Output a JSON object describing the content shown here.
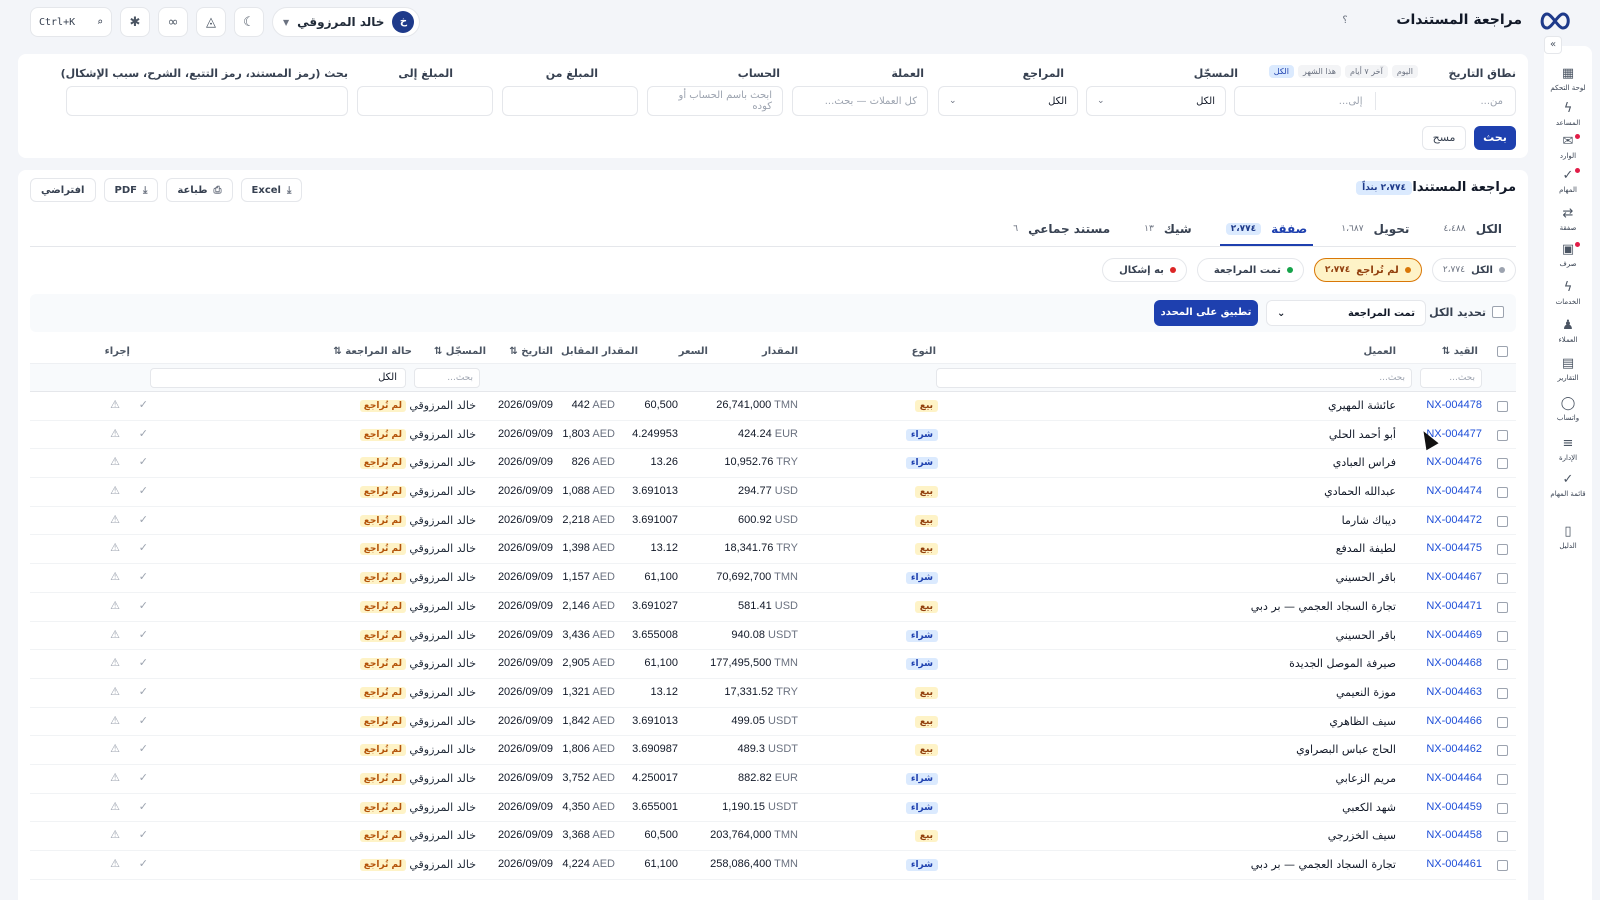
{
  "header": {
    "title": "مراجعة المستندات",
    "help": "؟",
    "search_shortcut": "Ctrl+K",
    "user_name": "خالد المرزوقي",
    "user_initial": "خ"
  },
  "sidebar": [
    {
      "label": "لوحة التحكم",
      "icon": "grid-icon",
      "glyph": "▦"
    },
    {
      "label": "المساعد",
      "icon": "bolt-icon",
      "glyph": "ϟ"
    },
    {
      "label": "الوارد",
      "icon": "inbox-icon",
      "glyph": "✉",
      "dot": true
    },
    {
      "label": "المهام",
      "icon": "check-icon",
      "glyph": "✓",
      "dot": true
    },
    {
      "label": "صفقة",
      "icon": "exchange-icon",
      "glyph": "⇄"
    },
    {
      "label": "صرف",
      "icon": "cash-icon",
      "glyph": "▣",
      "dot": true
    },
    {
      "label": "الخدمات",
      "icon": "bolt-icon",
      "glyph": "ϟ"
    },
    {
      "label": "العملاء",
      "icon": "users-icon",
      "glyph": "♟"
    },
    {
      "label": "التقارير",
      "icon": "report-icon",
      "glyph": "▤"
    },
    {
      "label": "واتساب",
      "icon": "chat-icon",
      "glyph": "◯"
    },
    {
      "label": "الإدارة",
      "icon": "sliders-icon",
      "glyph": "≡"
    },
    {
      "label": "قائمة المهام",
      "icon": "list-check-icon",
      "glyph": "✓"
    },
    {
      "label": "الدليل",
      "icon": "book-icon",
      "glyph": "▯"
    }
  ],
  "filters": {
    "date_label": "نطاق التاريخ",
    "quick": [
      "اليوم",
      "آخر ٧ أيام",
      "هذا الشهر",
      "الكل"
    ],
    "from_ph": "من...",
    "to_ph": "إلى...",
    "registrar_label": "المسجّل",
    "registrar_value": "الكل",
    "reviewer_label": "المراجع",
    "reviewer_value": "الكل",
    "currency_label": "العملة",
    "currency_ph": "كل العملات — بحث...",
    "account_label": "الحساب",
    "account_ph": "ابحث باسم الحساب أو كوده",
    "amount_from_label": "المبلغ من",
    "amount_to_label": "المبلغ إلى",
    "search_label": "بحث (رمز المستند، رمز التتبع، الشرح، سبب الإشكال)",
    "search_btn": "بحث",
    "clear_btn": "مسح"
  },
  "main": {
    "title": "مراجعة المستندات",
    "count_badge": "٢،٧٧٤ بنداً",
    "exports": {
      "excel": "Excel",
      "print": "طباعة",
      "pdf": "PDF",
      "default": "افتراضي"
    },
    "tabs": [
      {
        "label": "الكل",
        "count": "٤،٤٨٨"
      },
      {
        "label": "تحويل",
        "count": "١،٦٨٧"
      },
      {
        "label": "صفقة",
        "count": "٢،٧٧٤",
        "active": true
      },
      {
        "label": "شيك",
        "count": "١٣"
      },
      {
        "label": "مستند جماعي",
        "count": "٦"
      }
    ],
    "status_pills": [
      {
        "label": "الكل",
        "count": "٢،٧٧٤",
        "color": "#9ca3af"
      },
      {
        "label": "لم تُراجع",
        "count": "٢،٧٧٤",
        "color": "#d97706",
        "active": true
      },
      {
        "label": "تمت المراجعة",
        "count": "",
        "color": "#16a34a"
      },
      {
        "label": "به إشكال",
        "count": "",
        "color": "#dc2626"
      }
    ],
    "bulk": {
      "select_all": "تحديد الكل",
      "action_value": "تمت المراجعة",
      "apply_btn": "تطبيق على المحدد"
    }
  },
  "table": {
    "headers": {
      "ref": "القيد ⇅",
      "customer": "العميل",
      "type": "النوع",
      "amount": "المقدار",
      "rate": "السعر",
      "counter": "المقدار المقابل",
      "date": "التاريخ ⇅",
      "registrar": "المسجّل ⇅",
      "status": "حالة المراجعة ⇅",
      "action": "إجراء"
    },
    "filter_ph": "بحث...",
    "status_filter": "الكل",
    "rows": [
      {
        "ref": "NX-004478",
        "customer": "عائشة المهيري",
        "type": "بيع",
        "kind": "sell",
        "amount": "26,741,000",
        "cur": "TMN",
        "rate": "60,500",
        "counter": "442",
        "counter_cur": "AED",
        "date": "2026/09/09",
        "registrar": "خالد المرزوقي",
        "status": "لم تُراجع"
      },
      {
        "ref": "NX-004477",
        "customer": "أبو أحمد الحلي",
        "type": "شراء",
        "kind": "buy",
        "amount": "424.24",
        "cur": "EUR",
        "rate": "4.249953",
        "counter": "1,803",
        "counter_cur": "AED",
        "date": "2026/09/09",
        "registrar": "خالد المرزوقي",
        "status": "لم تُراجع"
      },
      {
        "ref": "NX-004476",
        "customer": "فراس العبادي",
        "type": "شراء",
        "kind": "buy",
        "amount": "10,952.76",
        "cur": "TRY",
        "rate": "13.26",
        "counter": "826",
        "counter_cur": "AED",
        "date": "2026/09/09",
        "registrar": "خالد المرزوقي",
        "status": "لم تُراجع"
      },
      {
        "ref": "NX-004474",
        "customer": "عبدالله الحمادي",
        "type": "بيع",
        "kind": "sell",
        "amount": "294.77",
        "cur": "USD",
        "rate": "3.691013",
        "counter": "1,088",
        "counter_cur": "AED",
        "date": "2026/09/09",
        "registrar": "خالد المرزوقي",
        "status": "لم تُراجع"
      },
      {
        "ref": "NX-004472",
        "customer": "ديباك شارما",
        "type": "بيع",
        "kind": "sell",
        "amount": "600.92",
        "cur": "USD",
        "rate": "3.691007",
        "counter": "2,218",
        "counter_cur": "AED",
        "date": "2026/09/09",
        "registrar": "خالد المرزوقي",
        "status": "لم تُراجع"
      },
      {
        "ref": "NX-004475",
        "customer": "لطيفة المدفع",
        "type": "بيع",
        "kind": "sell",
        "amount": "18,341.76",
        "cur": "TRY",
        "rate": "13.12",
        "counter": "1,398",
        "counter_cur": "AED",
        "date": "2026/09/09",
        "registrar": "خالد المرزوقي",
        "status": "لم تُراجع"
      },
      {
        "ref": "NX-004467",
        "customer": "باقر الحسيني",
        "type": "شراء",
        "kind": "buy",
        "amount": "70,692,700",
        "cur": "TMN",
        "rate": "61,100",
        "counter": "1,157",
        "counter_cur": "AED",
        "date": "2026/09/09",
        "registrar": "خالد المرزوقي",
        "status": "لم تُراجع"
      },
      {
        "ref": "NX-004471",
        "customer": "تجارة السجاد العجمي — بر دبي",
        "type": "بيع",
        "kind": "sell",
        "amount": "581.41",
        "cur": "USD",
        "rate": "3.691027",
        "counter": "2,146",
        "counter_cur": "AED",
        "date": "2026/09/09",
        "registrar": "خالد المرزوقي",
        "status": "لم تُراجع"
      },
      {
        "ref": "NX-004469",
        "customer": "باقر الحسيني",
        "type": "شراء",
        "kind": "buy",
        "amount": "940.08",
        "cur": "USDT",
        "rate": "3.655008",
        "counter": "3,436",
        "counter_cur": "AED",
        "date": "2026/09/09",
        "registrar": "خالد المرزوقي",
        "status": "لم تُراجع"
      },
      {
        "ref": "NX-004468",
        "customer": "صيرفة الموصل الجديدة",
        "type": "شراء",
        "kind": "buy",
        "amount": "177,495,500",
        "cur": "TMN",
        "rate": "61,100",
        "counter": "2,905",
        "counter_cur": "AED",
        "date": "2026/09/09",
        "registrar": "خالد المرزوقي",
        "status": "لم تُراجع"
      },
      {
        "ref": "NX-004463",
        "customer": "موزة النعيمي",
        "type": "بيع",
        "kind": "sell",
        "amount": "17,331.52",
        "cur": "TRY",
        "rate": "13.12",
        "counter": "1,321",
        "counter_cur": "AED",
        "date": "2026/09/09",
        "registrar": "خالد المرزوقي",
        "status": "لم تُراجع"
      },
      {
        "ref": "NX-004466",
        "customer": "سيف الظاهري",
        "type": "بيع",
        "kind": "sell",
        "amount": "499.05",
        "cur": "USDT",
        "rate": "3.691013",
        "counter": "1,842",
        "counter_cur": "AED",
        "date": "2026/09/09",
        "registrar": "خالد المرزوقي",
        "status": "لم تُراجع"
      },
      {
        "ref": "NX-004462",
        "customer": "الحاج عباس البصراوي",
        "type": "بيع",
        "kind": "sell",
        "amount": "489.3",
        "cur": "USDT",
        "rate": "3.690987",
        "counter": "1,806",
        "counter_cur": "AED",
        "date": "2026/09/09",
        "registrar": "خالد المرزوقي",
        "status": "لم تُراجع"
      },
      {
        "ref": "NX-004464",
        "customer": "مريم الزعابي",
        "type": "شراء",
        "kind": "buy",
        "amount": "882.82",
        "cur": "EUR",
        "rate": "4.250017",
        "counter": "3,752",
        "counter_cur": "AED",
        "date": "2026/09/09",
        "registrar": "خالد المرزوقي",
        "status": "لم تُراجع"
      },
      {
        "ref": "NX-004459",
        "customer": "شهد الكعبي",
        "type": "شراء",
        "kind": "buy",
        "amount": "1,190.15",
        "cur": "USDT",
        "rate": "3.655001",
        "counter": "4,350",
        "counter_cur": "AED",
        "date": "2026/09/09",
        "registrar": "خالد المرزوقي",
        "status": "لم تُراجع"
      },
      {
        "ref": "NX-004458",
        "customer": "سيف الخزرجي",
        "type": "بيع",
        "kind": "sell",
        "amount": "203,764,000",
        "cur": "TMN",
        "rate": "60,500",
        "counter": "3,368",
        "counter_cur": "AED",
        "date": "2026/09/09",
        "registrar": "خالد المرزوقي",
        "status": "لم تُراجع"
      },
      {
        "ref": "NX-004461",
        "customer": "تجارة السجاد العجمي — بر دبي",
        "type": "شراء",
        "kind": "buy",
        "amount": "258,086,400",
        "cur": "TMN",
        "rate": "61,100",
        "counter": "4,224",
        "counter_cur": "AED",
        "date": "2026/09/09",
        "registrar": "خالد المرزوقي",
        "status": "لم تُراجع"
      }
    ]
  }
}
